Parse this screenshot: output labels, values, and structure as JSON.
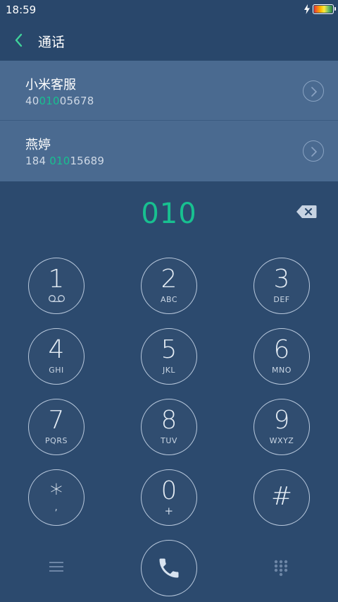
{
  "status_bar": {
    "time": "18:59",
    "icons": [
      "charging-bolt-icon",
      "battery-icon"
    ]
  },
  "header": {
    "back_icon": "chevron-left-icon",
    "title": "通话"
  },
  "suggestions": [
    {
      "name": "小米客服",
      "number_prefix": "40",
      "number_match": "010",
      "number_suffix": "05678"
    },
    {
      "name": "燕婷",
      "number_prefix": "184 ",
      "number_match": "010",
      "number_suffix": "15689"
    }
  ],
  "dialer": {
    "input_value": "010",
    "backspace_icon": "backspace-icon",
    "keys": [
      {
        "digit": "1",
        "letters": "",
        "sub_icon": "voicemail-icon"
      },
      {
        "digit": "2",
        "letters": "ABC"
      },
      {
        "digit": "3",
        "letters": "DEF"
      },
      {
        "digit": "4",
        "letters": "GHI"
      },
      {
        "digit": "5",
        "letters": "JKL"
      },
      {
        "digit": "6",
        "letters": "MNO"
      },
      {
        "digit": "7",
        "letters": "PQRS"
      },
      {
        "digit": "8",
        "letters": "TUV"
      },
      {
        "digit": "9",
        "letters": "WXYZ"
      },
      {
        "digit": "*",
        "letters": ","
      },
      {
        "digit": "0",
        "letters": "+"
      },
      {
        "digit": "#",
        "letters": ""
      }
    ]
  },
  "bottom_bar": {
    "menu_icon": "menu-icon",
    "call_icon": "phone-icon",
    "keypad_icon": "dialpad-icon"
  },
  "colors": {
    "background": "#2c4a6e",
    "header": "#29476b",
    "suggestion_row": "#4a6a90",
    "accent_green": "#18c090",
    "key_border": "#b8c8dc"
  }
}
